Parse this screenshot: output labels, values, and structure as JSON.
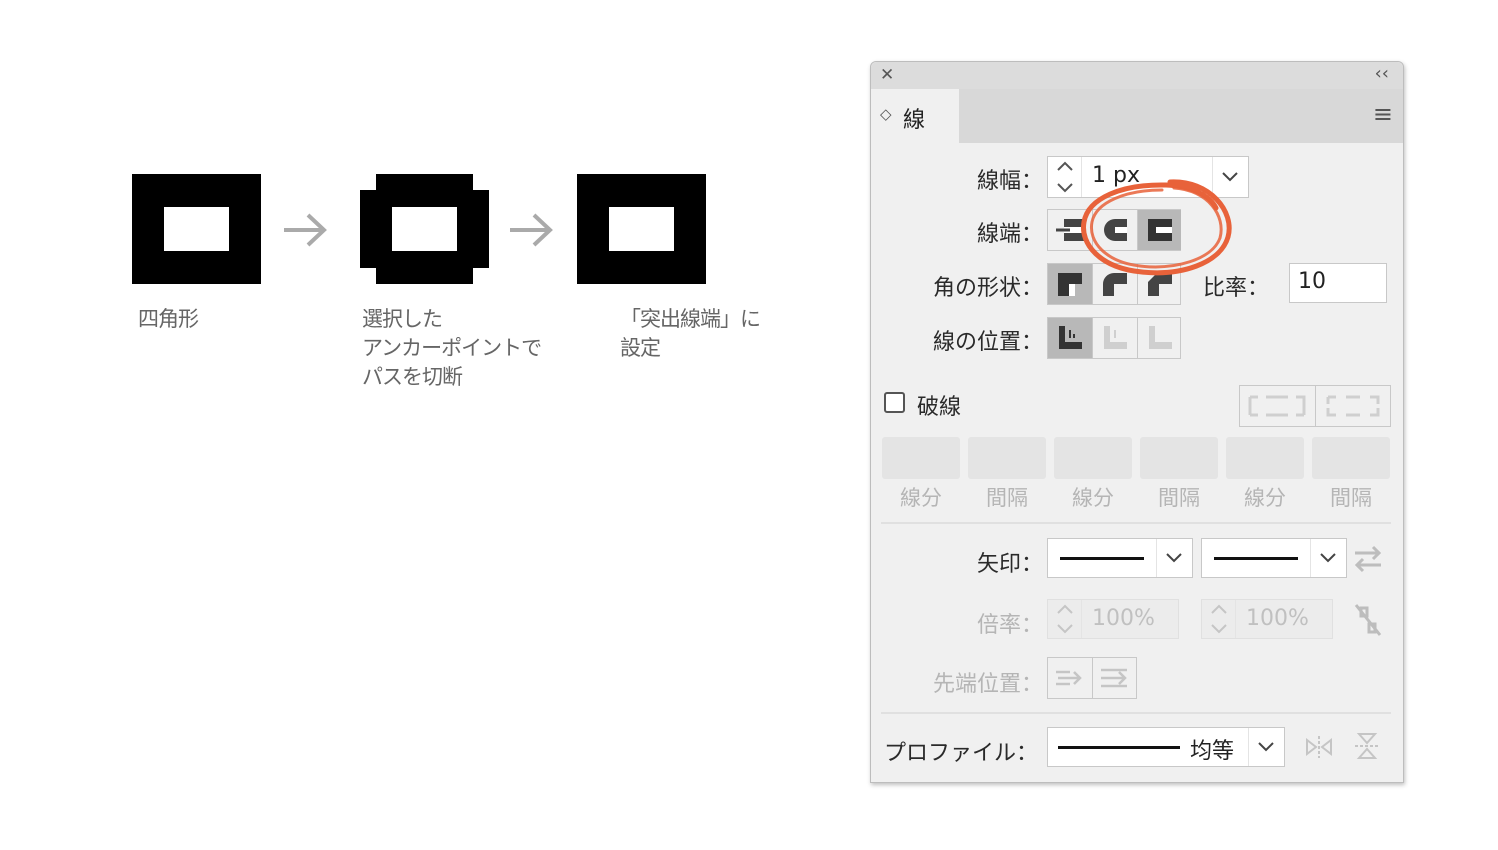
{
  "illustration": {
    "note1": "四角形",
    "note2_line1": "選択した",
    "note2_line2": "アンカーポイントで",
    "note2_line3": "パスを切断",
    "note3_line1": "「突出線端」に",
    "note3_line2": "設定"
  },
  "panel": {
    "close_glyph": "✕",
    "collapse_glyph": "‹‹",
    "tab_label": "線",
    "tab_updown_glyph": "◇",
    "menu_glyph": "≡",
    "weight_label": "線幅：",
    "weight_value": "1 px",
    "cap_label": "線端：",
    "corner_label": "角の形状：",
    "limit_label": "比率：",
    "limit_value": "10",
    "align_label": "線の位置：",
    "dashed_label": "破線",
    "dash_labels": [
      "線分",
      "間隔",
      "線分",
      "間隔",
      "線分",
      "間隔"
    ],
    "arrow_label": "矢印：",
    "scale_label": "倍率：",
    "scale_start": "100%",
    "scale_end": "100%",
    "tip_label": "先端位置：",
    "profile_label": "プロファイル：",
    "profile_value": "均等",
    "accent_color": "#e8623a"
  }
}
